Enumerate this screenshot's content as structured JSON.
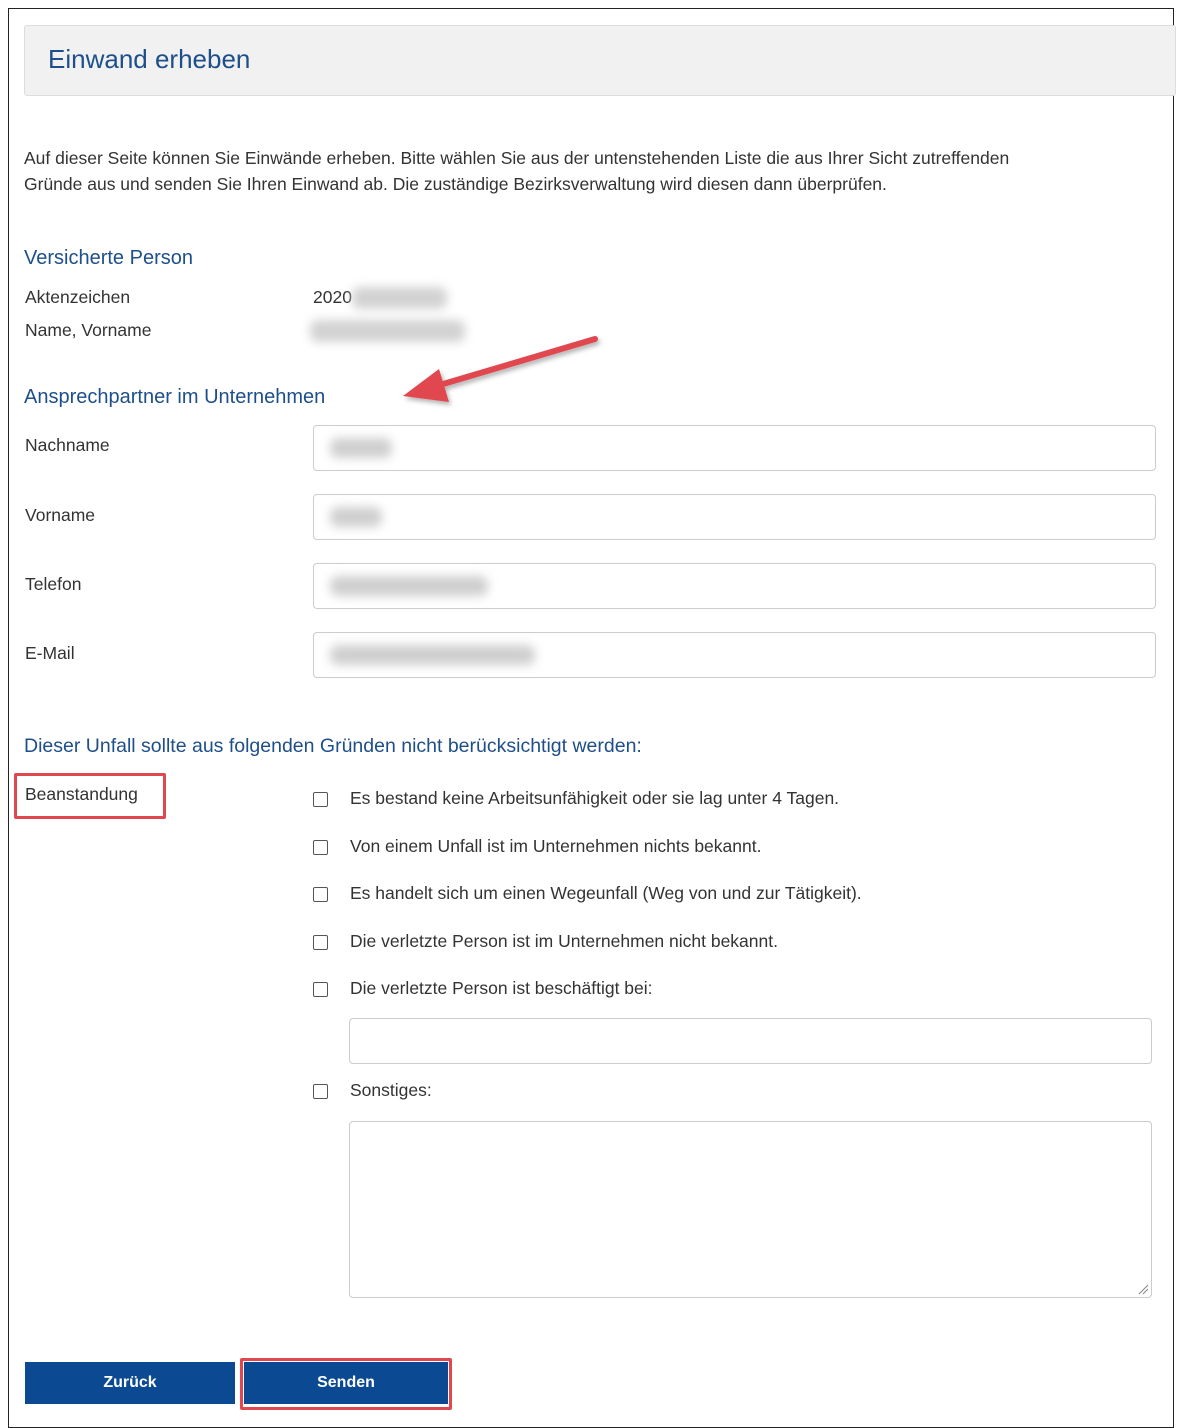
{
  "page": {
    "title": "Einwand erheben",
    "intro_line1": "Auf dieser Seite können Sie Einwände erheben. Bitte wählen Sie aus der untenstehenden Liste die aus Ihrer Sicht zutreffenden",
    "intro_line2": "Gründe aus und senden Sie Ihren Einwand ab. Die zuständige Bezirksverwaltung wird diesen dann überprüfen."
  },
  "insured": {
    "heading": "Versicherte Person",
    "file_label": "Aktenzeichen",
    "file_value_visible": "2020",
    "name_label": "Name, Vorname"
  },
  "contact": {
    "heading": "Ansprechpartner im Unternehmen",
    "lastname_label": "Nachname",
    "firstname_label": "Vorname",
    "phone_label": "Telefon",
    "email_label": "E-Mail"
  },
  "reasons": {
    "heading": "Dieser Unfall sollte aus folgenden Gründen nicht berücksichtigt werden:",
    "complaint_label": "Beanstandung",
    "options": [
      "Es bestand keine Arbeitsunfähigkeit oder sie lag unter 4 Tagen.",
      "Von einem Unfall ist im Unternehmen nichts bekannt.",
      "Es handelt sich um einen Wegeunfall (Weg von und zur Tätigkeit).",
      "Die verletzte Person ist im Unternehmen nicht bekannt.",
      "Die verletzte Person ist beschäftigt bei:",
      "Sonstiges:"
    ]
  },
  "buttons": {
    "back": "Zurück",
    "send": "Senden"
  },
  "colors": {
    "heading_blue": "#1e4f8a",
    "button_blue": "#0b4a92",
    "highlight_red": "#e0474f"
  }
}
